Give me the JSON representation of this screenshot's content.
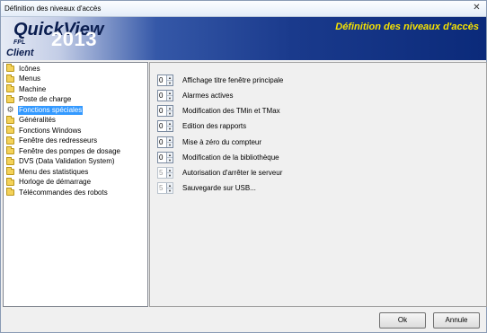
{
  "window": {
    "title": "Définition des niveaux d'accès",
    "close_icon": "close-icon"
  },
  "header": {
    "brand": "QuickView",
    "sub": "FPL",
    "year": "2013",
    "client": "Client",
    "heading": "Définition des niveaux d'accès",
    "heading_color": "#f6e200"
  },
  "tree": {
    "items": [
      {
        "label": "Icônes",
        "icon": "folder-icon"
      },
      {
        "label": "Menus",
        "icon": "folder-icon"
      },
      {
        "label": "Machine",
        "icon": "folder-icon"
      },
      {
        "label": "Poste de charge",
        "icon": "folder-icon"
      },
      {
        "label": "Fonctions spéciales",
        "icon": "gear-icon",
        "selected": true
      },
      {
        "label": "Généralités",
        "icon": "folder-icon"
      },
      {
        "label": "Fonctions Windows",
        "icon": "folder-icon"
      },
      {
        "label": "Fenêtre des redresseurs",
        "icon": "folder-icon"
      },
      {
        "label": "Fenêtre des pompes de dosage",
        "icon": "folder-icon"
      },
      {
        "label": "DVS (Data Validation System)",
        "icon": "folder-icon"
      },
      {
        "label": "Menu des statistiques",
        "icon": "folder-icon"
      },
      {
        "label": "Horloge de démarrage",
        "icon": "folder-icon"
      },
      {
        "label": "Télécommandes des robots",
        "icon": "folder-icon"
      }
    ]
  },
  "settings": [
    {
      "value": "0",
      "label": "Affichage titre fenêtre principale",
      "enabled": true
    },
    {
      "value": "0",
      "label": "Alarmes actives",
      "enabled": true
    },
    {
      "value": "0",
      "label": "Modification des TMin et TMax",
      "enabled": true
    },
    {
      "value": "0",
      "label": "Edition des rapports",
      "enabled": true
    },
    {
      "value": "0",
      "label": "Mise à zéro du compteur",
      "enabled": true
    },
    {
      "value": "0",
      "label": "Modification de la bibliothèque",
      "enabled": true
    },
    {
      "value": "5",
      "label": "Autorisation d'arrêter le serveur",
      "enabled": false
    },
    {
      "value": "5",
      "label": "Sauvegarde sur USB...",
      "enabled": false
    }
  ],
  "buttons": {
    "ok": "Ok",
    "cancel": "Annule"
  }
}
